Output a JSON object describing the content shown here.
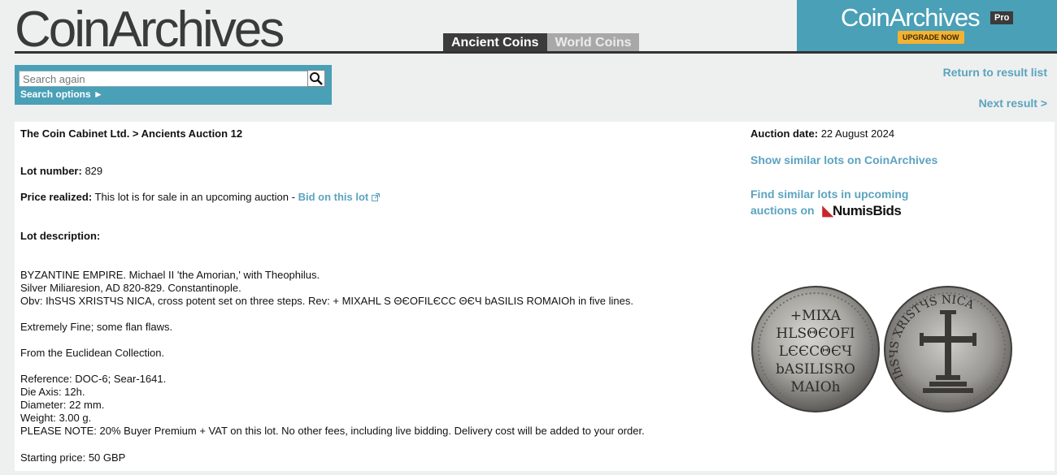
{
  "logo": "CoinArchives",
  "tabs": {
    "ancient": "Ancient Coins",
    "world": "World Coins"
  },
  "pro_banner": {
    "title": "CoinArchives",
    "badge": "Pro",
    "upgrade": "UPGRADE NOW"
  },
  "search": {
    "placeholder": "Search again",
    "options_label": "Search options ►"
  },
  "nav": {
    "return": "Return to result list",
    "next": "Next result >"
  },
  "auction": {
    "breadcrumb": "The Coin Cabinet Ltd. > Ancients Auction 12",
    "date_label": "Auction date:",
    "date_value": "22 August 2024"
  },
  "lot": {
    "number_label": "Lot number:",
    "number_value": "829",
    "price_label": "Price realized:",
    "price_text": "This lot is for sale in an upcoming auction -",
    "bid_link": "Bid on this lot",
    "description_label": "Lot description:"
  },
  "side": {
    "similar": "Show similar lots on CoinArchives",
    "upcoming_line1": "Find similar lots in upcoming",
    "upcoming_line2": "auctions on",
    "numisbids_logo": "NumisBids"
  },
  "description": {
    "line1": "BYZANTINE EMPIRE. Michael II 'the Amorian,' with Theophilus.",
    "line2": "Silver Miliaresion, AD 820-829. Constantinople.",
    "line3": "Obv: IhSЧS XRISTЧS NICA, cross potent set on three steps. Rev: + MIXAHL S ΘЄOFILЄCC ΘЄЧ bASILIS ROMAIOh in five lines.",
    "grade": "Extremely Fine; some flan flaws.",
    "provenance": "From the Euclidean Collection.",
    "reference": "Reference: DOC-6; Sear-1641.",
    "die_axis": "Die Axis: 12h.",
    "diameter": "Diameter: 22 mm.",
    "weight": "Weight: 3.00 g.",
    "note": "PLEASE NOTE: 20% Buyer Premium + VAT on this lot. No other fees, including live bidding. Delivery cost will be added to your order.",
    "starting_price": "Starting price: 50 GBP"
  },
  "coin_obverse_legend": [
    "+MIXA",
    "HLSΘЄOFI",
    "LЄЄCΘЄЧ",
    "bASILISRO",
    "MAIOh"
  ],
  "coin_reverse_legend": "IhSЧS XRISTЧS NICA",
  "colors": {
    "accent": "#4aa0b6",
    "link": "#5ba3bf",
    "upgrade": "#f2b234"
  },
  "icons": {
    "search": "search-icon",
    "external": "external-link-icon"
  }
}
